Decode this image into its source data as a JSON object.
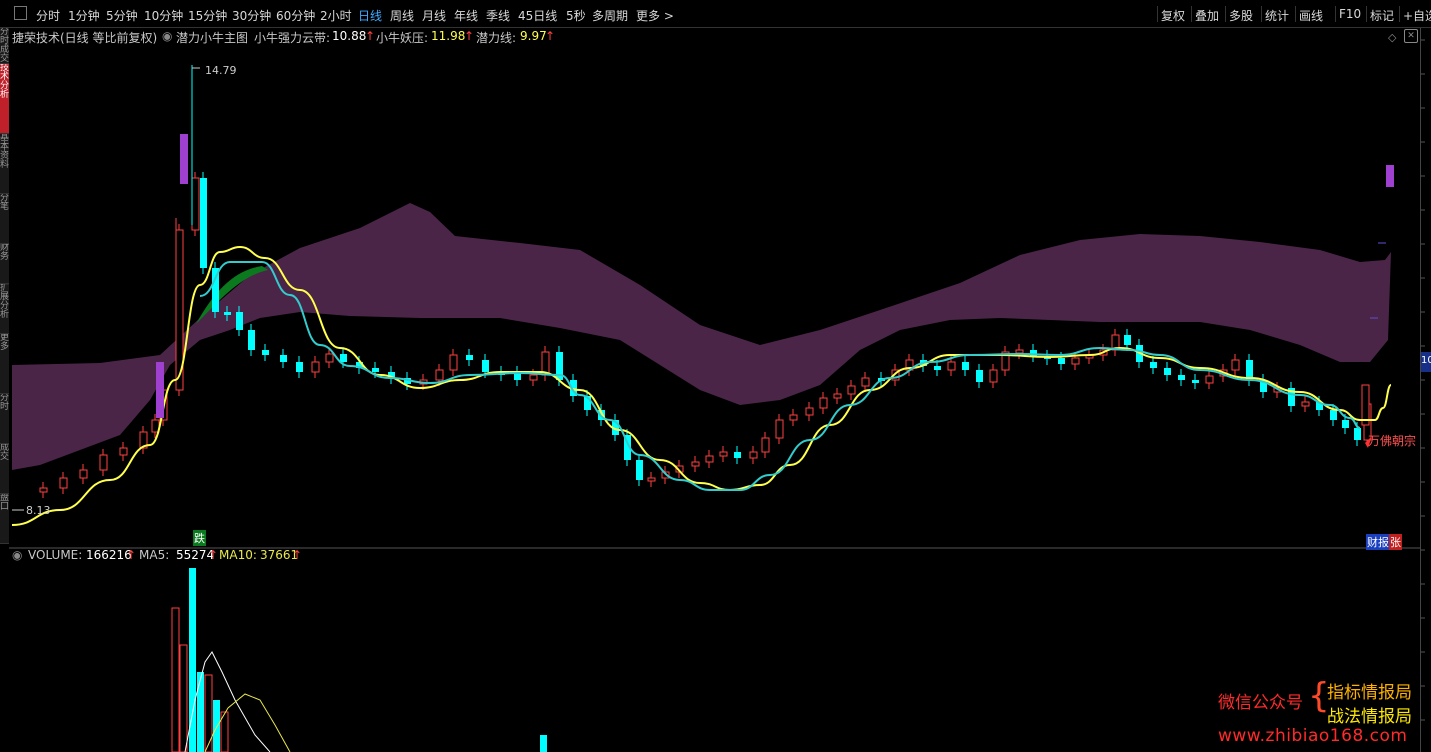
{
  "toolbar": {
    "periods": [
      "分时",
      "1分钟",
      "5分钟",
      "10分钟",
      "15分钟",
      "30分钟",
      "60分钟",
      "2小时",
      "日线",
      "周线",
      "月线",
      "年线",
      "季线",
      "45日线",
      "5秒",
      "多周期",
      "更多 >"
    ],
    "active": "日线",
    "right_buttons": [
      "复权",
      "叠加",
      "多股",
      "统计",
      "画线",
      "F10",
      "标记",
      "+自选"
    ]
  },
  "left_tabs": [
    "分时成交",
    "技术分析",
    "基本资料",
    "分笔",
    "财务",
    "扩展分析",
    "更多",
    "分时",
    "成交",
    "盘口"
  ],
  "legend": {
    "stock": "捷荣技术(日线 等比前复权)",
    "indicator": "潜力小牛主图",
    "yun_label": "小牛强力云带:",
    "yun_value": "10.88",
    "yao_label": "小牛妖压:",
    "yao_value": "11.98",
    "qian_label": "潜力线:",
    "qian_value": "9.97",
    "arrow": "↑"
  },
  "price_labels": {
    "high": "14.79",
    "low": "8.13"
  },
  "annotations": {
    "die": "跌",
    "wanfo": "万佛朝宗",
    "caibao": "财报",
    "zhang": "张",
    "right_axis": "10"
  },
  "volume_legend": {
    "volume_label": "VOLUME:",
    "volume_value": "166216",
    "ma5_label": "MA5:",
    "ma5_value": "55274",
    "ma10_label": "MA10:",
    "ma10_value": "37661",
    "arrow": "↑"
  },
  "watermark": {
    "wechat": "微信公众号",
    "brace": "{",
    "line1": "指标情报局",
    "line2": "战法情报局",
    "url": "www.zhibiao168.com"
  },
  "colors": {
    "up": "#ff4040",
    "down": "#00ffff",
    "active_tab": "#41a9ff",
    "cloud": "#4a2548",
    "yellow_line": "#ffff4d",
    "cyan_line": "#33cccc"
  }
}
